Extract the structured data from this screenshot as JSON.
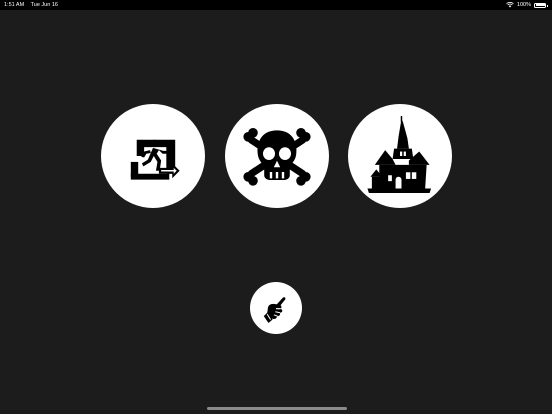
{
  "status_bar": {
    "time": "1:51 AM",
    "date": "Tue Jun 16",
    "battery": "100%"
  },
  "icons": {
    "option_1": "emergency-exit-icon",
    "option_2": "skull-crossbones-icon",
    "option_3": "haunted-house-icon",
    "action": "pointing-hand-icon"
  },
  "colors": {
    "background": "#1c1c1c",
    "circle": "#ffffff",
    "glyph": "#000000"
  }
}
